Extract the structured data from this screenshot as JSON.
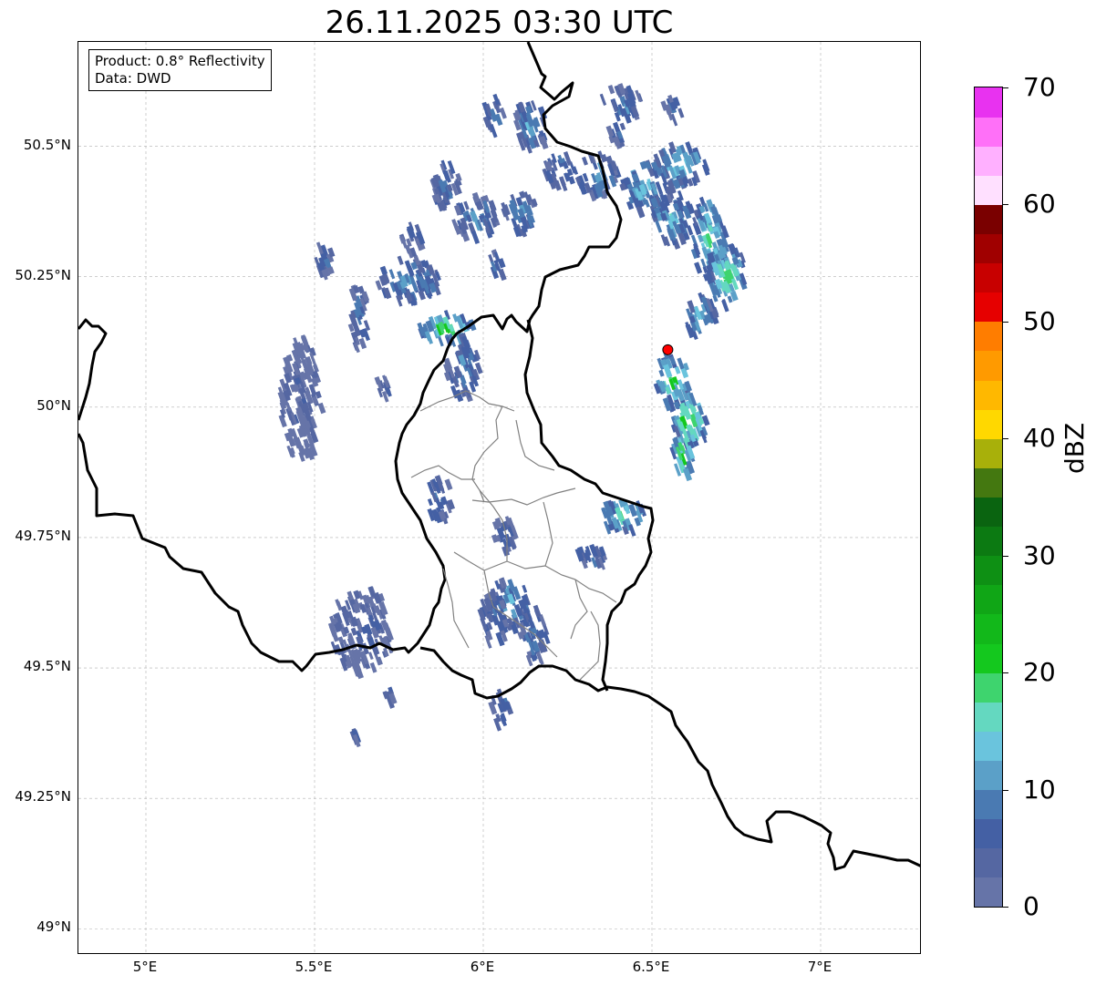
{
  "title": "26.11.2025 03:30 UTC",
  "info_box": {
    "line1": "Product: 0.8° Reflectivity",
    "line2": "Data: DWD"
  },
  "map": {
    "lon_range": [
      4.8,
      7.3
    ],
    "lat_range": [
      48.95,
      50.7
    ],
    "lat_ticks": [
      {
        "value": 50.5,
        "label": "50.5°N"
      },
      {
        "value": 50.25,
        "label": "50.25°N"
      },
      {
        "value": 50.0,
        "label": "50°N"
      },
      {
        "value": 49.75,
        "label": "49.75°N"
      },
      {
        "value": 49.5,
        "label": "49.5°N"
      },
      {
        "value": 49.25,
        "label": "49.25°N"
      },
      {
        "value": 49.0,
        "label": "49°N"
      }
    ],
    "lon_ticks": [
      {
        "value": 5.0,
        "label": "5°E"
      },
      {
        "value": 5.5,
        "label": "5.5°E"
      },
      {
        "value": 6.0,
        "label": "6°E"
      },
      {
        "value": 6.5,
        "label": "6.5°E"
      },
      {
        "value": 7.0,
        "label": "7°E"
      }
    ],
    "radar_site": {
      "lon": 6.547,
      "lat": 50.11,
      "color": "#ff0000"
    },
    "gridlines": true
  },
  "colorbar": {
    "label": "dBZ",
    "min": 0,
    "max": 70,
    "ticks": [
      "0",
      "10",
      "20",
      "30",
      "40",
      "50",
      "60",
      "70"
    ],
    "colors": [
      "#6674a8",
      "#5567a2",
      "#4460a4",
      "#4a7ab2",
      "#5ba0c8",
      "#6ac4dd",
      "#64d8c0",
      "#3ed46e",
      "#14c81e",
      "#12b81a",
      "#10a616",
      "#0e9014",
      "#0c7a12",
      "#0a6410",
      "#447810",
      "#a8b00a",
      "#ffd800",
      "#ffb800",
      "#ff9a00",
      "#ff7d00",
      "#e60000",
      "#c80000",
      "#a00000",
      "#7a0000",
      "#ffe0ff",
      "#ffb0ff",
      "#ff70f8",
      "#e832f0"
    ]
  },
  "echo_cells": [
    {
      "lon": 5.88,
      "lat": 50.16,
      "rlon": 0.08,
      "rlat": 0.03,
      "dbz": 22
    },
    {
      "lon": 5.77,
      "lat": 50.25,
      "rlon": 0.1,
      "rlat": 0.04,
      "dbz": 12
    },
    {
      "lon": 5.52,
      "lat": 50.29,
      "rlon": 0.03,
      "rlat": 0.03,
      "dbz": 8
    },
    {
      "lon": 5.62,
      "lat": 50.18,
      "rlon": 0.03,
      "rlat": 0.06,
      "dbz": 8
    },
    {
      "lon": 5.45,
      "lat": 50.02,
      "rlon": 0.06,
      "rlat": 0.12,
      "dbz": 3
    },
    {
      "lon": 5.93,
      "lat": 50.08,
      "rlon": 0.05,
      "rlat": 0.06,
      "dbz": 10
    },
    {
      "lon": 5.69,
      "lat": 50.05,
      "rlon": 0.02,
      "rlat": 0.03,
      "dbz": 5
    },
    {
      "lon": 5.63,
      "lat": 49.58,
      "rlon": 0.09,
      "rlat": 0.08,
      "dbz": 4
    },
    {
      "lon": 5.86,
      "lat": 49.83,
      "rlon": 0.04,
      "rlat": 0.04,
      "dbz": 8
    },
    {
      "lon": 6.07,
      "lat": 49.63,
      "rlon": 0.06,
      "rlat": 0.05,
      "dbz": 12
    },
    {
      "lon": 6.02,
      "lat": 49.6,
      "rlon": 0.04,
      "rlat": 0.05,
      "dbz": 8
    },
    {
      "lon": 6.14,
      "lat": 49.57,
      "rlon": 0.04,
      "rlat": 0.05,
      "dbz": 10
    },
    {
      "lon": 6.05,
      "lat": 49.76,
      "rlon": 0.03,
      "rlat": 0.04,
      "dbz": 6
    },
    {
      "lon": 6.31,
      "lat": 49.72,
      "rlon": 0.05,
      "rlat": 0.02,
      "dbz": 10
    },
    {
      "lon": 6.4,
      "lat": 49.8,
      "rlon": 0.07,
      "rlat": 0.03,
      "dbz": 18
    },
    {
      "lon": 6.04,
      "lat": 49.43,
      "rlon": 0.03,
      "rlat": 0.03,
      "dbz": 8
    },
    {
      "lon": 5.97,
      "lat": 50.37,
      "rlon": 0.07,
      "rlat": 0.04,
      "dbz": 10
    },
    {
      "lon": 5.88,
      "lat": 50.43,
      "rlon": 0.04,
      "rlat": 0.05,
      "dbz": 8
    },
    {
      "lon": 6.13,
      "lat": 50.55,
      "rlon": 0.05,
      "rlat": 0.05,
      "dbz": 12
    },
    {
      "lon": 6.22,
      "lat": 50.46,
      "rlon": 0.05,
      "rlat": 0.03,
      "dbz": 10
    },
    {
      "lon": 6.33,
      "lat": 50.45,
      "rlon": 0.06,
      "rlat": 0.04,
      "dbz": 12
    },
    {
      "lon": 6.1,
      "lat": 50.38,
      "rlon": 0.05,
      "rlat": 0.04,
      "dbz": 12
    },
    {
      "lon": 6.47,
      "lat": 50.43,
      "rlon": 0.08,
      "rlat": 0.05,
      "dbz": 14
    },
    {
      "lon": 6.57,
      "lat": 50.47,
      "rlon": 0.08,
      "rlat": 0.04,
      "dbz": 16
    },
    {
      "lon": 6.55,
      "lat": 50.37,
      "rlon": 0.06,
      "rlat": 0.05,
      "dbz": 14
    },
    {
      "lon": 6.66,
      "lat": 50.33,
      "rlon": 0.05,
      "rlat": 0.08,
      "dbz": 18
    },
    {
      "lon": 6.71,
      "lat": 50.26,
      "rlon": 0.06,
      "rlat": 0.06,
      "dbz": 20
    },
    {
      "lon": 6.63,
      "lat": 50.18,
      "rlon": 0.05,
      "rlat": 0.04,
      "dbz": 14
    },
    {
      "lon": 6.55,
      "lat": 50.06,
      "rlon": 0.05,
      "rlat": 0.05,
      "dbz": 22
    },
    {
      "lon": 6.6,
      "lat": 49.98,
      "rlon": 0.05,
      "rlat": 0.05,
      "dbz": 24
    },
    {
      "lon": 6.58,
      "lat": 49.92,
      "rlon": 0.03,
      "rlat": 0.05,
      "dbz": 22
    },
    {
      "lon": 6.4,
      "lat": 50.59,
      "rlon": 0.06,
      "rlat": 0.03,
      "dbz": 10
    },
    {
      "lon": 6.55,
      "lat": 50.58,
      "rlon": 0.03,
      "rlat": 0.02,
      "dbz": 6
    },
    {
      "lon": 6.39,
      "lat": 50.53,
      "rlon": 0.03,
      "rlat": 0.02,
      "dbz": 10
    },
    {
      "lon": 6.02,
      "lat": 50.57,
      "rlon": 0.03,
      "rlat": 0.03,
      "dbz": 10
    },
    {
      "lon": 6.03,
      "lat": 50.28,
      "rlon": 0.02,
      "rlat": 0.03,
      "dbz": 8
    },
    {
      "lon": 5.78,
      "lat": 50.33,
      "rlon": 0.03,
      "rlat": 0.03,
      "dbz": 6
    },
    {
      "lon": 5.71,
      "lat": 49.46,
      "rlon": 0.02,
      "rlat": 0.02,
      "dbz": 4
    },
    {
      "lon": 5.61,
      "lat": 49.38,
      "rlon": 0.01,
      "rlat": 0.01,
      "dbz": 4
    }
  ]
}
